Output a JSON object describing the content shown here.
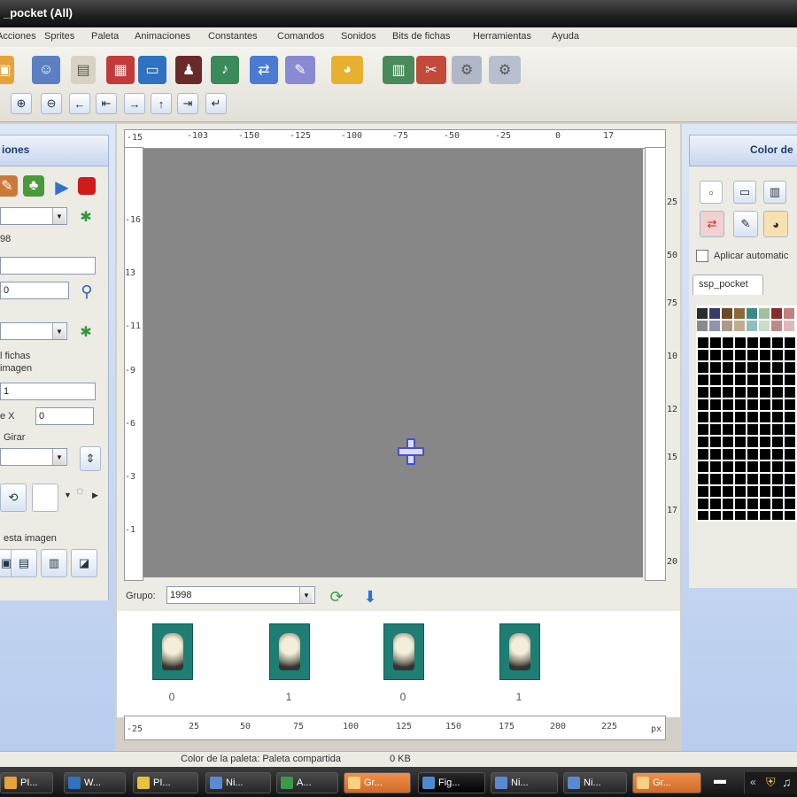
{
  "window": {
    "title": "_pocket (All)"
  },
  "menu": [
    "Acciones",
    "Sprites",
    "Paleta",
    "Animaciones",
    "Constantes",
    "Comandos",
    "Sonidos",
    "Bits de fichas",
    "Herramientas",
    "Ayuda"
  ],
  "left_panel": {
    "title": "iones",
    "value_1": "98",
    "value_2": "0",
    "label_fichas": "l fichas",
    "label_imagen": "imagen",
    "value_3": "1",
    "label_x": "e X",
    "value_x": "0",
    "label_girar": "Girar",
    "label_esta_imagen": "esta imagen"
  },
  "ruler_top": [
    "-15",
    "-103",
    "-150",
    "-125",
    "-100",
    "-75",
    "-50",
    "-25",
    "0",
    "17"
  ],
  "ruler_left": [
    "-16",
    "13",
    "-11",
    "-9",
    "-6",
    "-3",
    "-1"
  ],
  "ruler_right": [
    "25",
    "50",
    "75",
    "10",
    "12",
    "15",
    "17",
    "20"
  ],
  "group": {
    "label": "Grupo:",
    "value": "1998"
  },
  "thumbnails": [
    {
      "index": "0"
    },
    {
      "index": "1"
    },
    {
      "index": "0"
    },
    {
      "index": "1"
    }
  ],
  "ruler_bottom": [
    "-25",
    "25",
    "50",
    "75",
    "100",
    "125",
    "150",
    "175",
    "200",
    "225",
    "px"
  ],
  "right_panel": {
    "title": "Color de",
    "checkbox_label": "Aplicar automatic",
    "tab_label": "ssp_pocket",
    "swatches": [
      "#2b2b2b",
      "#3a3a6a",
      "#6a4a2a",
      "#8b6a3a",
      "#3a8a8a",
      "#a0c0a0",
      "#8a2a2a",
      "#c08080"
    ]
  },
  "status": {
    "palette_text": "Color de la paleta: Paleta compartida",
    "size_text": "0 KB"
  },
  "taskbar": [
    {
      "label": "PI..."
    },
    {
      "label": "W..."
    },
    {
      "label": "PI..."
    },
    {
      "label": "Ni..."
    },
    {
      "label": "A..."
    },
    {
      "label": "Gr..."
    },
    {
      "label": "Fig..."
    },
    {
      "label": "Ni..."
    },
    {
      "label": "Ni..."
    },
    {
      "label": "Gr..."
    }
  ],
  "colors": {
    "canvas": "#878787",
    "accent": "#c8d8f0"
  }
}
